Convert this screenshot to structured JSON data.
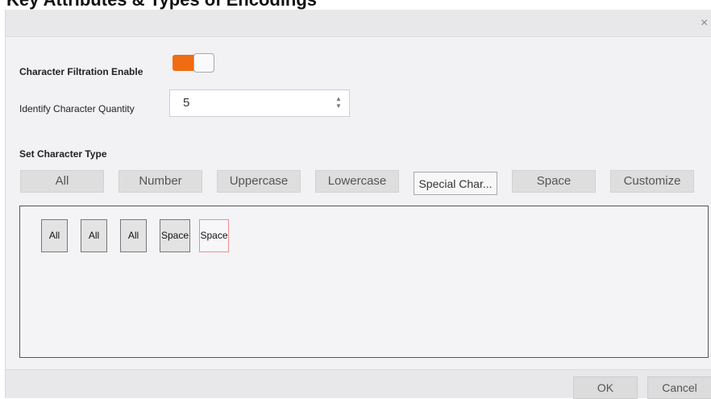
{
  "page_heading": "Key Attributes & Types of Encodings",
  "dialog": {
    "close_glyph": "×"
  },
  "filtration": {
    "label": "Character Filtration Enable",
    "enabled": true,
    "accent_color": "#f06c12"
  },
  "quantity": {
    "label": "Identify Character Quantity",
    "value": "5"
  },
  "char_type": {
    "heading": "Set Character Type",
    "buttons": [
      "All",
      "Number",
      "Uppercase",
      "Lowercase",
      "Special Char...",
      "Space",
      "Customize"
    ]
  },
  "sequence": {
    "chips": [
      "All",
      "All",
      "All",
      "Space",
      "Space"
    ],
    "active_index": 4
  },
  "footer": {
    "ok_label": "OK",
    "cancel_label": "Cancel"
  }
}
